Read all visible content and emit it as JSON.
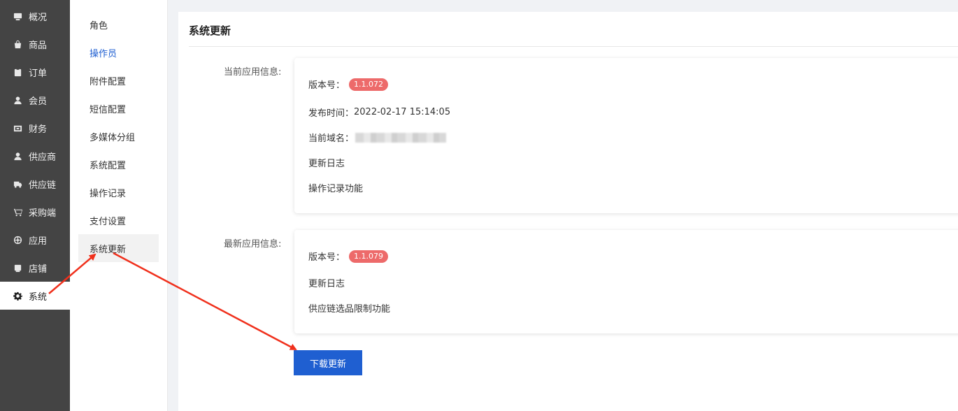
{
  "nav": {
    "items": [
      {
        "label": "概况",
        "icon": "monitor-icon"
      },
      {
        "label": "商品",
        "icon": "shopping-bag-icon"
      },
      {
        "label": "订单",
        "icon": "clipboard-icon"
      },
      {
        "label": "会员",
        "icon": "user-icon"
      },
      {
        "label": "财务",
        "icon": "wallet-icon"
      },
      {
        "label": "供应商",
        "icon": "person-icon"
      },
      {
        "label": "供应链",
        "icon": "truck-icon"
      },
      {
        "label": "采购端",
        "icon": "cart-icon"
      },
      {
        "label": "应用",
        "icon": "apps-wheel-icon"
      },
      {
        "label": "店铺",
        "icon": "store-icon"
      },
      {
        "label": "系统",
        "icon": "gear-icon"
      }
    ],
    "active_index": 10
  },
  "submenu": {
    "items": [
      "角色",
      "操作员",
      "附件配置",
      "短信配置",
      "多媒体分组",
      "系统配置",
      "操作记录",
      "支付设置",
      "系统更新"
    ]
  },
  "panel": {
    "title": "系统更新",
    "current": {
      "label": "当前应用信息:",
      "version_label": "版本号：",
      "version": "1.1.072",
      "release_label": "发布时间：",
      "release_time": "2022-02-17 15:14:05",
      "domain_label": "当前域名：",
      "log_title": "更新日志",
      "log_content": "操作记录功能"
    },
    "latest": {
      "label": "最新应用信息:",
      "version_label": "版本号：",
      "version": "1.1.079",
      "log_title": "更新日志",
      "log_content": "供应链选品限制功能"
    },
    "download_button": "下载更新"
  },
  "colors": {
    "nav_bg": "#444444",
    "accent_blue": "#1f5fd1",
    "badge_red": "#ed6a6a",
    "annotation_arrow": "#f0301c"
  }
}
